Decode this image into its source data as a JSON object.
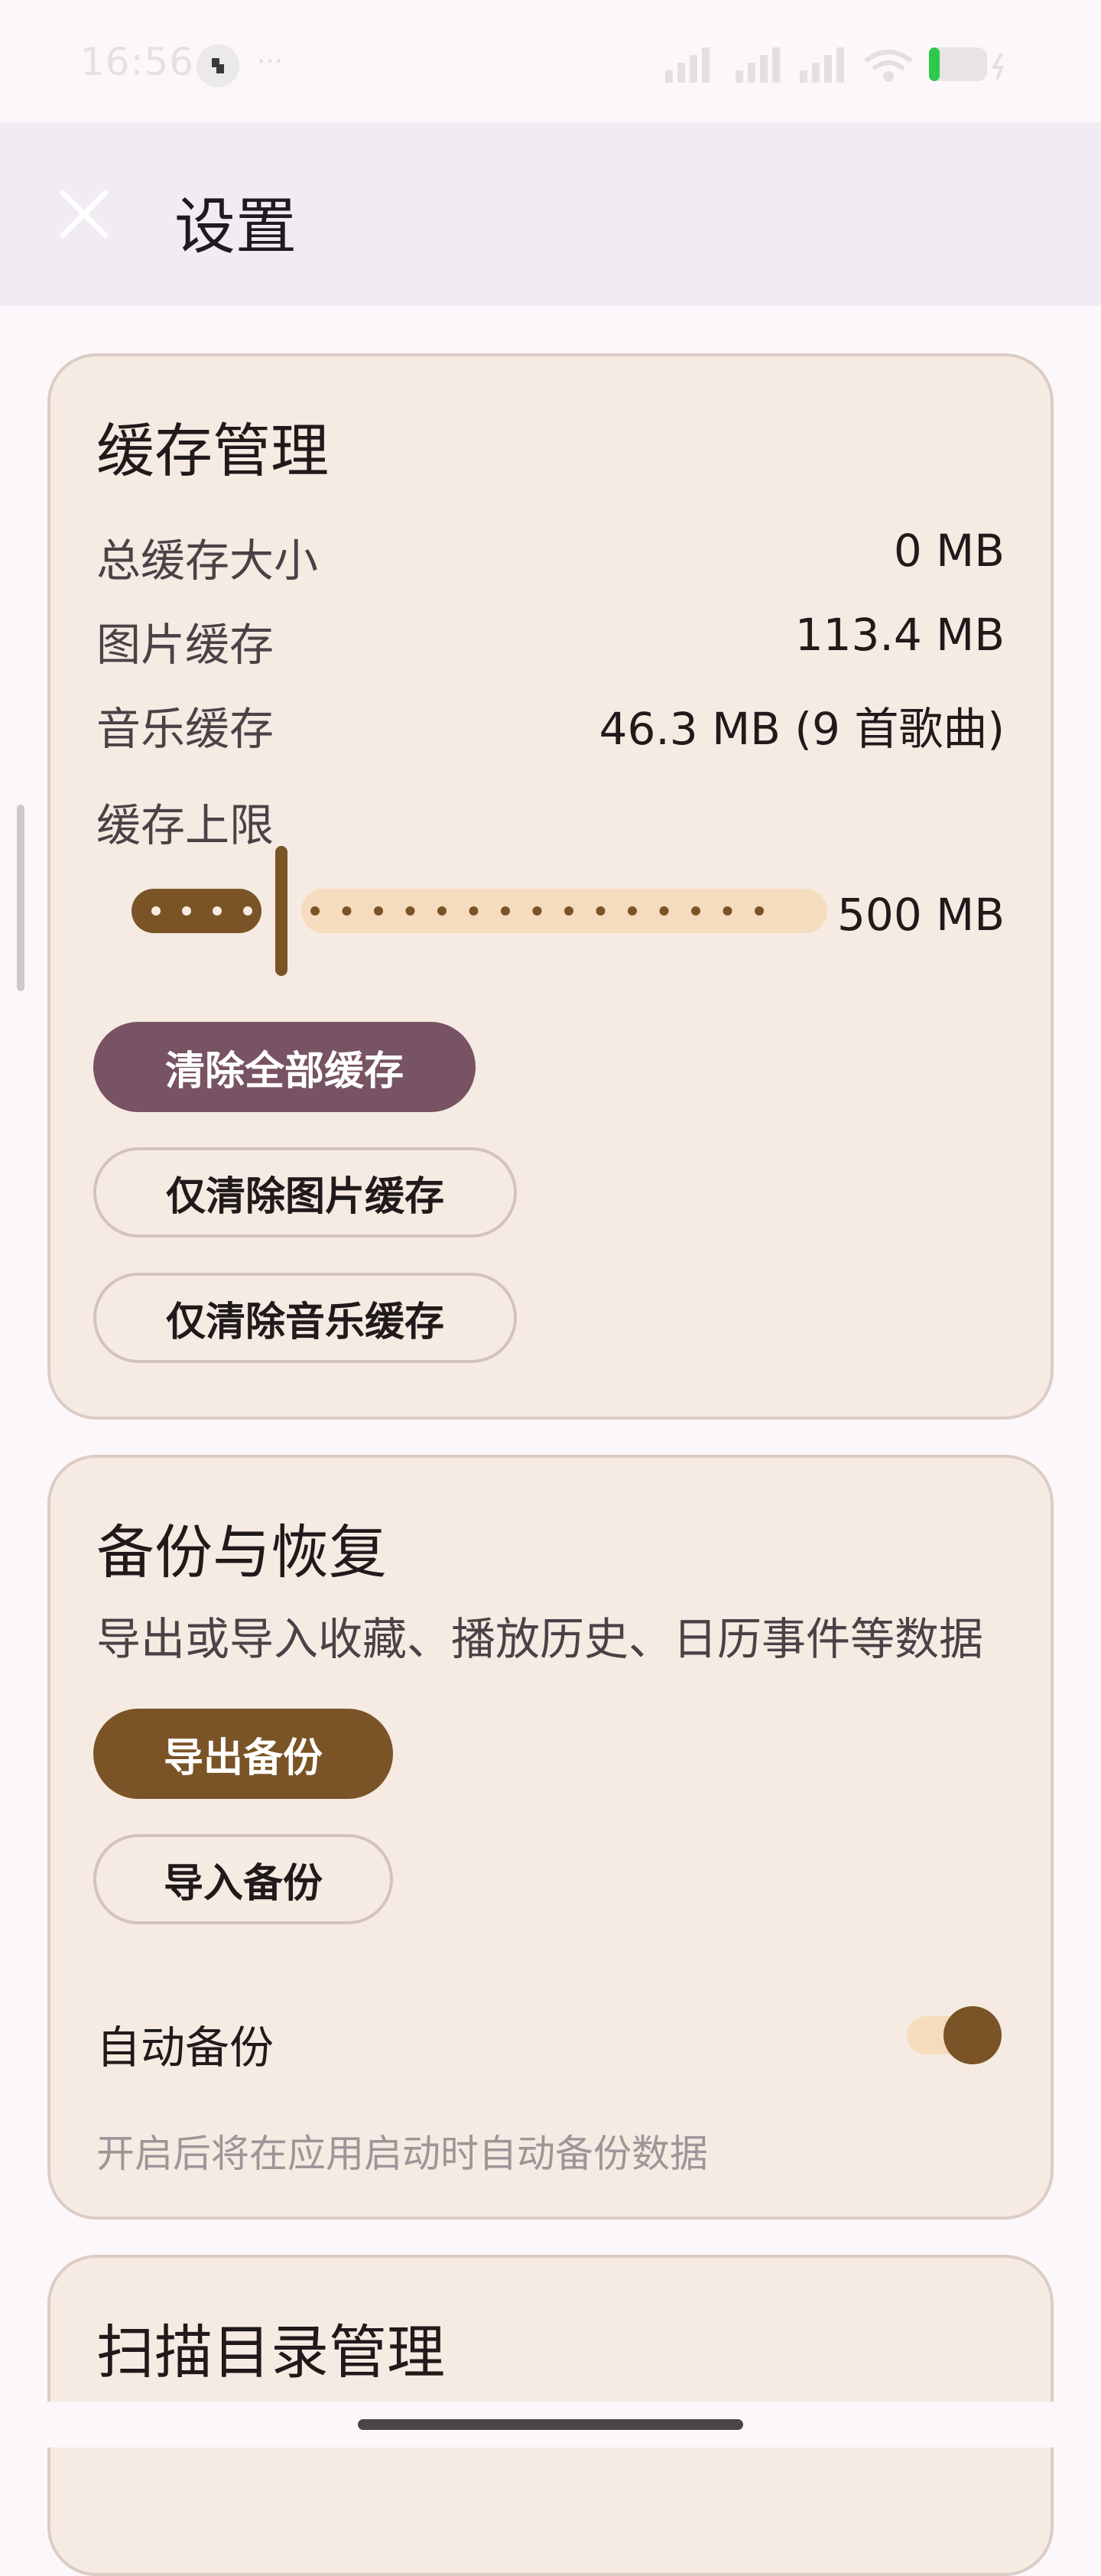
{
  "status_bar": {
    "time": "16:56",
    "dots": "···"
  },
  "app_bar": {
    "title": "设置"
  },
  "cache_card": {
    "title": "缓存管理",
    "rows": [
      {
        "label": "总缓存大小",
        "value": "0 MB"
      },
      {
        "label": "图片缓存",
        "value": "113.4 MB"
      },
      {
        "label": "音乐缓存",
        "value": "46.3 MB (9 首歌曲)"
      }
    ],
    "limit_label": "缓存上限",
    "limit_value": "500 MB",
    "limit_fraction": 0.2,
    "clear_all_label": "清除全部缓存",
    "clear_images_label": "仅清除图片缓存",
    "clear_music_label": "仅清除音乐缓存"
  },
  "backup_card": {
    "title": "备份与恢复",
    "description": "导出或导入收藏、播放历史、日历事件等数据",
    "export_label": "导出备份",
    "import_label": "导入备份",
    "auto_backup_label": "自动备份",
    "auto_backup_on": true,
    "auto_backup_hint": "开启后将在应用启动时自动备份数据"
  },
  "scan_card": {
    "title": "扫描目录管理"
  },
  "colors": {
    "card_bg": "#f6ebe3",
    "accent_brown": "#7a5426",
    "accent_mauve": "#775363",
    "track_light": "#f6dcbe"
  }
}
